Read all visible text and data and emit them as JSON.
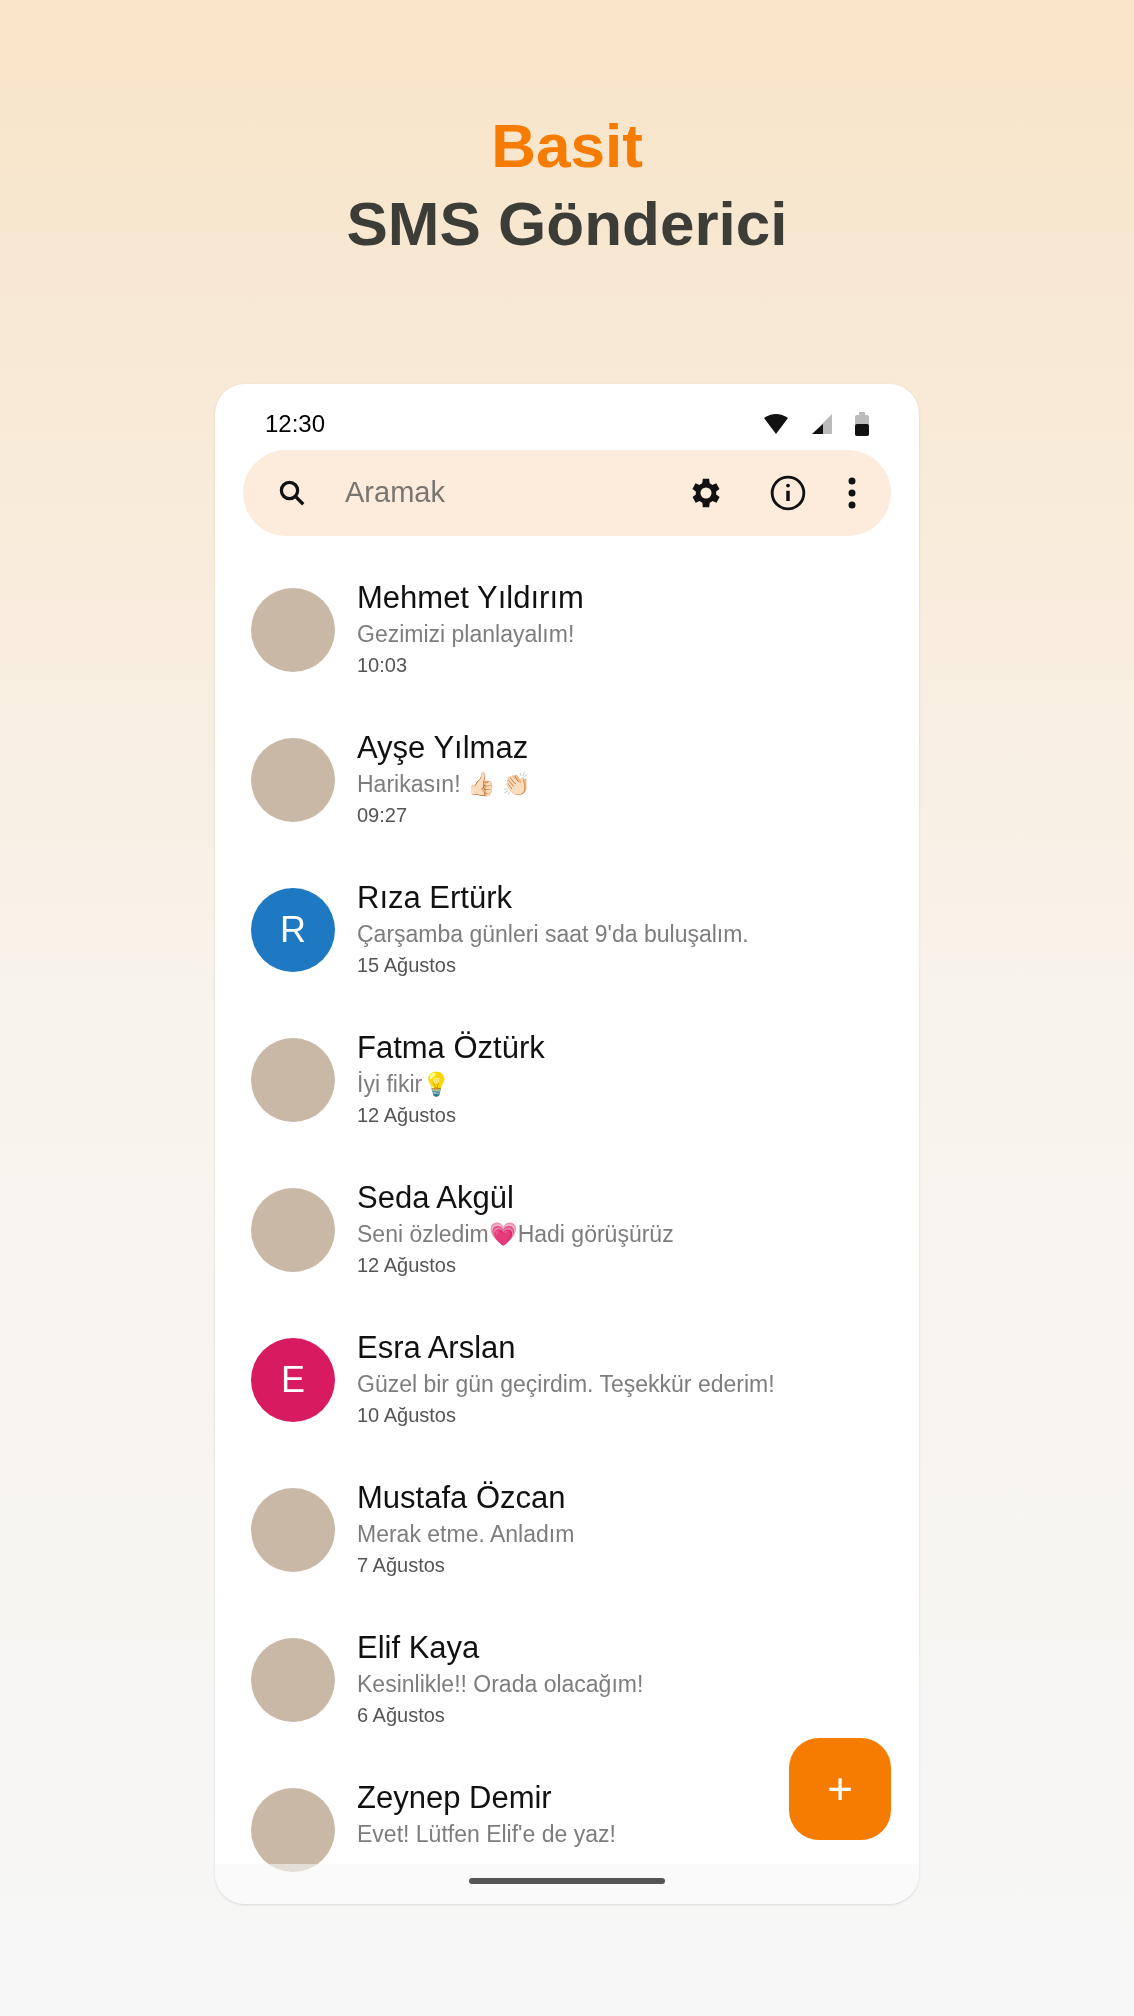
{
  "headline": {
    "accent": "Basit",
    "title": "SMS Gönderici"
  },
  "status_bar": {
    "time": "12:30"
  },
  "search": {
    "placeholder": "Aramak"
  },
  "conversations": [
    {
      "name": "Mehmet Yıldırım",
      "message": "Gezimizi planlayalım!",
      "time": "10:03",
      "avatar": {
        "kind": "photo"
      }
    },
    {
      "name": "Ayşe Yılmaz",
      "message": "Harikasın! 👍🏻 👏🏻",
      "time": "09:27",
      "avatar": {
        "kind": "photo"
      }
    },
    {
      "name": "Rıza Ertürk",
      "message": "Çarşamba günleri saat 9'da buluşalım.",
      "time": "15 Ağustos",
      "avatar": {
        "kind": "letter",
        "letter": "R",
        "color": "#1e78c2"
      }
    },
    {
      "name": "Fatma Öztürk",
      "message": "İyi fikir💡",
      "time": "12 Ağustos",
      "avatar": {
        "kind": "photo"
      }
    },
    {
      "name": "Seda Akgül",
      "message": "Seni özledim💗Hadi görüşürüz",
      "time": "12 Ağustos",
      "avatar": {
        "kind": "photo"
      }
    },
    {
      "name": "Esra Arslan",
      "message": "Güzel bir gün geçirdim. Teşekkür ederim!",
      "time": "10 Ağustos",
      "avatar": {
        "kind": "letter",
        "letter": "E",
        "color": "#d81b60"
      }
    },
    {
      "name": "Mustafa Özcan",
      "message": "Merak etme. Anladım",
      "time": "7 Ağustos",
      "avatar": {
        "kind": "photo"
      }
    },
    {
      "name": "Elif Kaya",
      "message": "Kesinlikle!! Orada olacağım!",
      "time": "6 Ağustos",
      "avatar": {
        "kind": "photo"
      }
    },
    {
      "name": "Zeynep Demir",
      "message": "Evet! Lütfen Elif'e de yaz!",
      "avatar": {
        "kind": "photo"
      }
    }
  ],
  "fab": {
    "label": "+"
  }
}
